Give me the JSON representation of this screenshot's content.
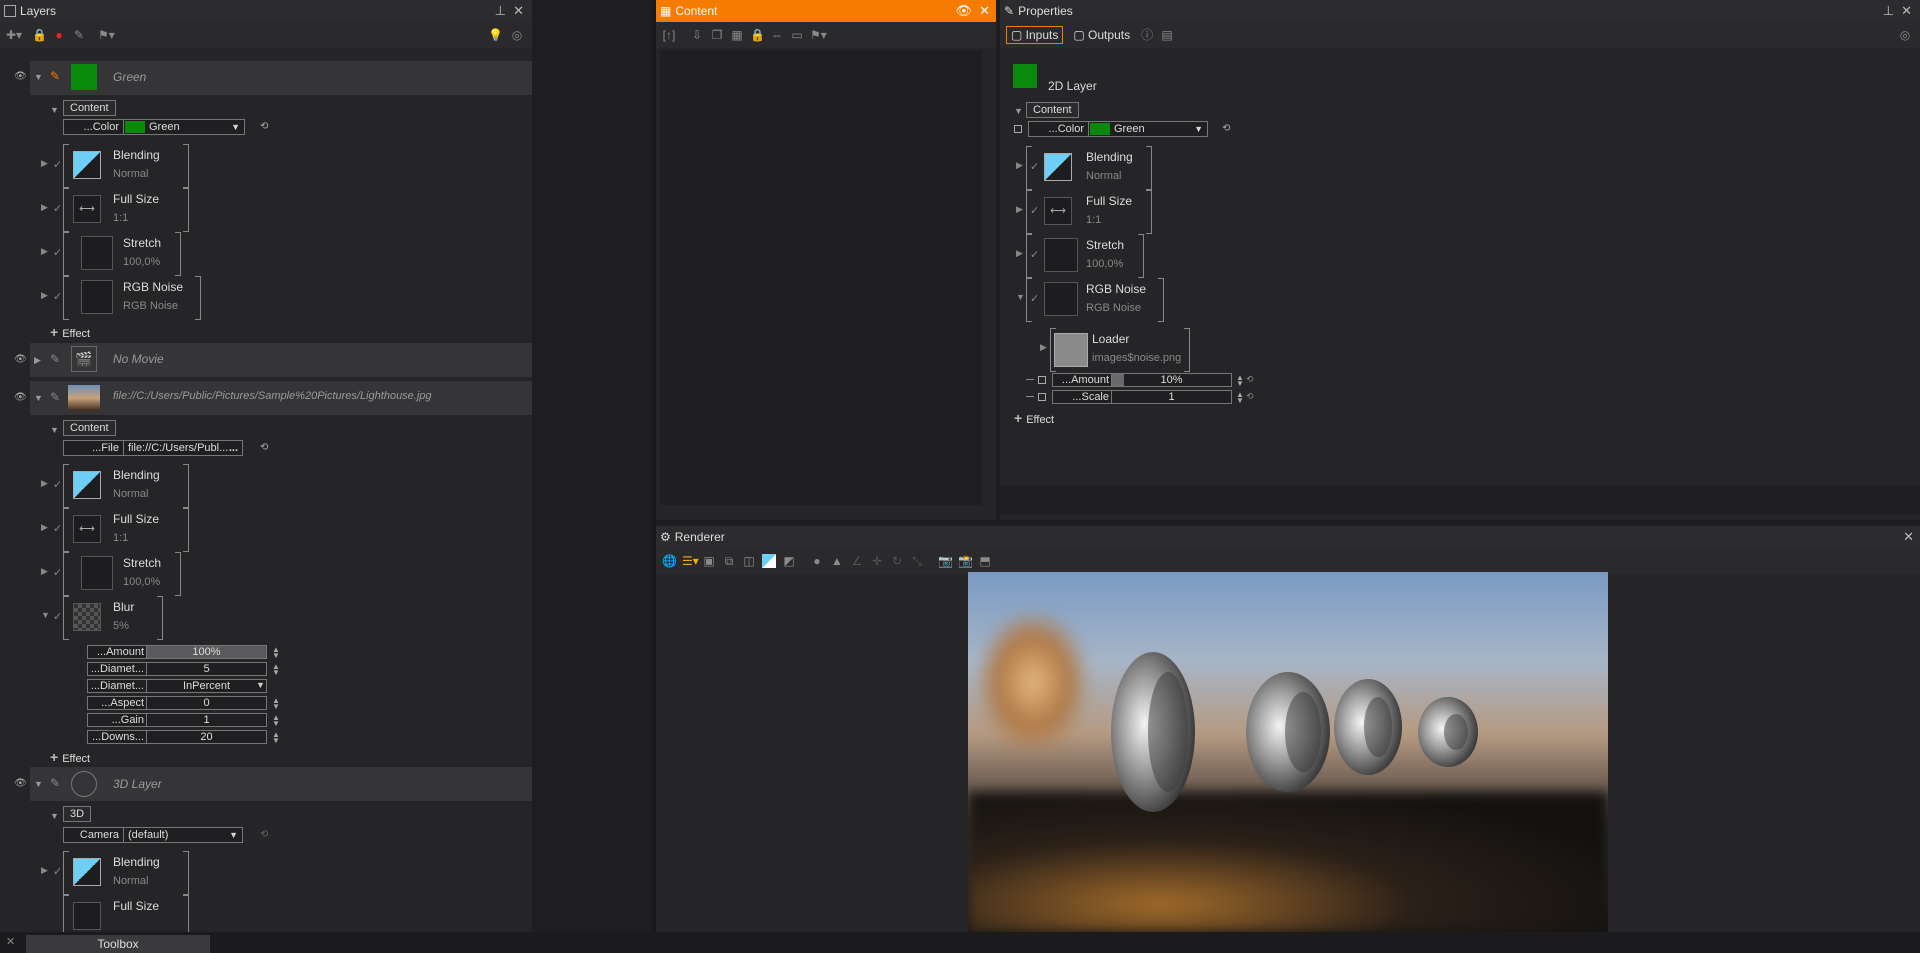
{
  "layers": {
    "title": "Layers",
    "items": [
      {
        "name": "Green",
        "content_label": "Content",
        "color_label": "...Color",
        "color_value": "Green",
        "effects": [
          {
            "name": "Blending",
            "sub": "Normal"
          },
          {
            "name": "Full Size",
            "sub": "1:1"
          },
          {
            "name": "Stretch",
            "sub": "100,0%"
          },
          {
            "name": "RGB Noise",
            "sub": "RGB Noise"
          }
        ],
        "add_effect": "Effect"
      },
      {
        "name": "No Movie"
      },
      {
        "name": "file://C:/Users/Public/Pictures/Sample%20Pictures/Lighthouse.jpg",
        "content_label": "Content",
        "file_label": "...File",
        "file_value": "file://C:/Users/Publ...",
        "file_btn": "...",
        "effects": [
          {
            "name": "Blending",
            "sub": "Normal"
          },
          {
            "name": "Full Size",
            "sub": "1:1"
          },
          {
            "name": "Stretch",
            "sub": "100,0%"
          },
          {
            "name": "Blur",
            "sub": "5%"
          }
        ],
        "blur_params": [
          {
            "label": "...Amount",
            "value": "100%"
          },
          {
            "label": "...Diamet...",
            "value": "5"
          },
          {
            "label": "...Diamet...",
            "value": "InPercent"
          },
          {
            "label": "...Aspect",
            "value": "0"
          },
          {
            "label": "...Gain",
            "value": "1"
          },
          {
            "label": "...Downs...",
            "value": "20"
          }
        ],
        "add_effect": "Effect"
      },
      {
        "name": "3D Layer",
        "group_label": "3D",
        "camera_label": "Camera",
        "camera_value": "(default)",
        "effects": [
          {
            "name": "Blending",
            "sub": "Normal"
          },
          {
            "name": "Full Size",
            "sub": ""
          }
        ]
      }
    ]
  },
  "content": {
    "title": "Content"
  },
  "properties": {
    "title": "Properties",
    "tab_inputs": "Inputs",
    "tab_outputs": "Outputs",
    "layer_type": "2D Layer",
    "content_label": "Content",
    "color_label": "...Color",
    "color_value": "Green",
    "effects": [
      {
        "name": "Blending",
        "sub": "Normal"
      },
      {
        "name": "Full Size",
        "sub": "1:1"
      },
      {
        "name": "Stretch",
        "sub": "100,0%"
      },
      {
        "name": "RGB Noise",
        "sub": "RGB Noise"
      }
    ],
    "loader": {
      "name": "Loader",
      "sub": "images$noise.png"
    },
    "params": [
      {
        "label": "...Amount",
        "value": "10%"
      },
      {
        "label": "...Scale",
        "value": "1"
      }
    ],
    "add_effect": "Effect"
  },
  "renderer": {
    "title": "Renderer"
  },
  "toolbox": {
    "title": "Toolbox"
  },
  "colors": {
    "accent": "#f57c00",
    "green": "#0a8a0a",
    "blend": "#6ecff6"
  }
}
